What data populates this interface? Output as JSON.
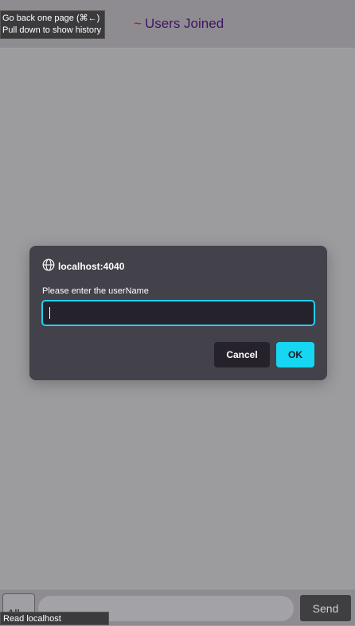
{
  "header": {
    "tilde": "~",
    "title": "Users Joined"
  },
  "back_tooltip": {
    "line1": "Go back one page (⌘←)",
    "line2": "Pull down to show history"
  },
  "dialog": {
    "origin": "localhost:4040",
    "origin_icon": "globe-icon",
    "message": "Please enter the userName",
    "input_value": "",
    "cancel_label": "Cancel",
    "ok_label": "OK",
    "accent_color": "#16d6f2"
  },
  "bottom": {
    "select_value": "All",
    "message_value": "",
    "send_label": "Send"
  },
  "status": {
    "text": "Read localhost"
  }
}
